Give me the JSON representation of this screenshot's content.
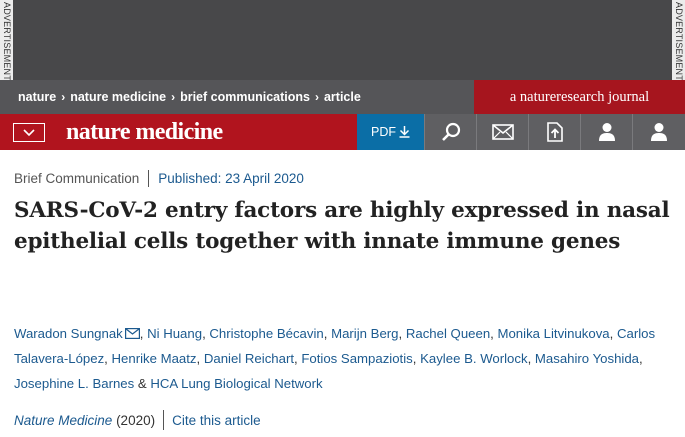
{
  "ad": {
    "label": "ADVERTISEMENT"
  },
  "breadcrumb": [
    {
      "label": "nature"
    },
    {
      "label": "nature medicine"
    },
    {
      "label": "brief communications"
    },
    {
      "label": "article"
    }
  ],
  "journal_tag": "a natureresearch journal",
  "header": {
    "logo": "nature medicine",
    "pdf_label": "PDF",
    "tools": [
      "search-icon",
      "mail-icon",
      "submit-icon",
      "user-icon",
      "account-icon"
    ]
  },
  "article": {
    "type": "Brief Communication",
    "published": "Published: 23 April 2020",
    "title": "SARS-CoV-2 entry factors are highly expressed in nasal epithelial cells together with innate immune genes",
    "authors": [
      "Waradon Sungnak",
      "Ni Huang",
      "Christophe Bécavin",
      "Marijn Berg",
      "Rachel Queen",
      "Monika Litvinukova",
      "Carlos Talavera-López",
      "Henrike Maatz",
      "Daniel Reichart",
      "Fotios Sampaziotis",
      "Kaylee B. Worlock",
      "Masahiro Yoshida",
      "Josephine L. Barnes",
      "HCA Lung Biological Network"
    ],
    "journal": "Nature Medicine",
    "year": "(2020)",
    "cite_label": "Cite this article"
  },
  "colors": {
    "brand_red": "#b1141e",
    "journal_red": "#a6151e",
    "pdf_blue": "#0b6ea6",
    "link_blue": "#1c5a8f",
    "nav_gray": "#555558"
  }
}
